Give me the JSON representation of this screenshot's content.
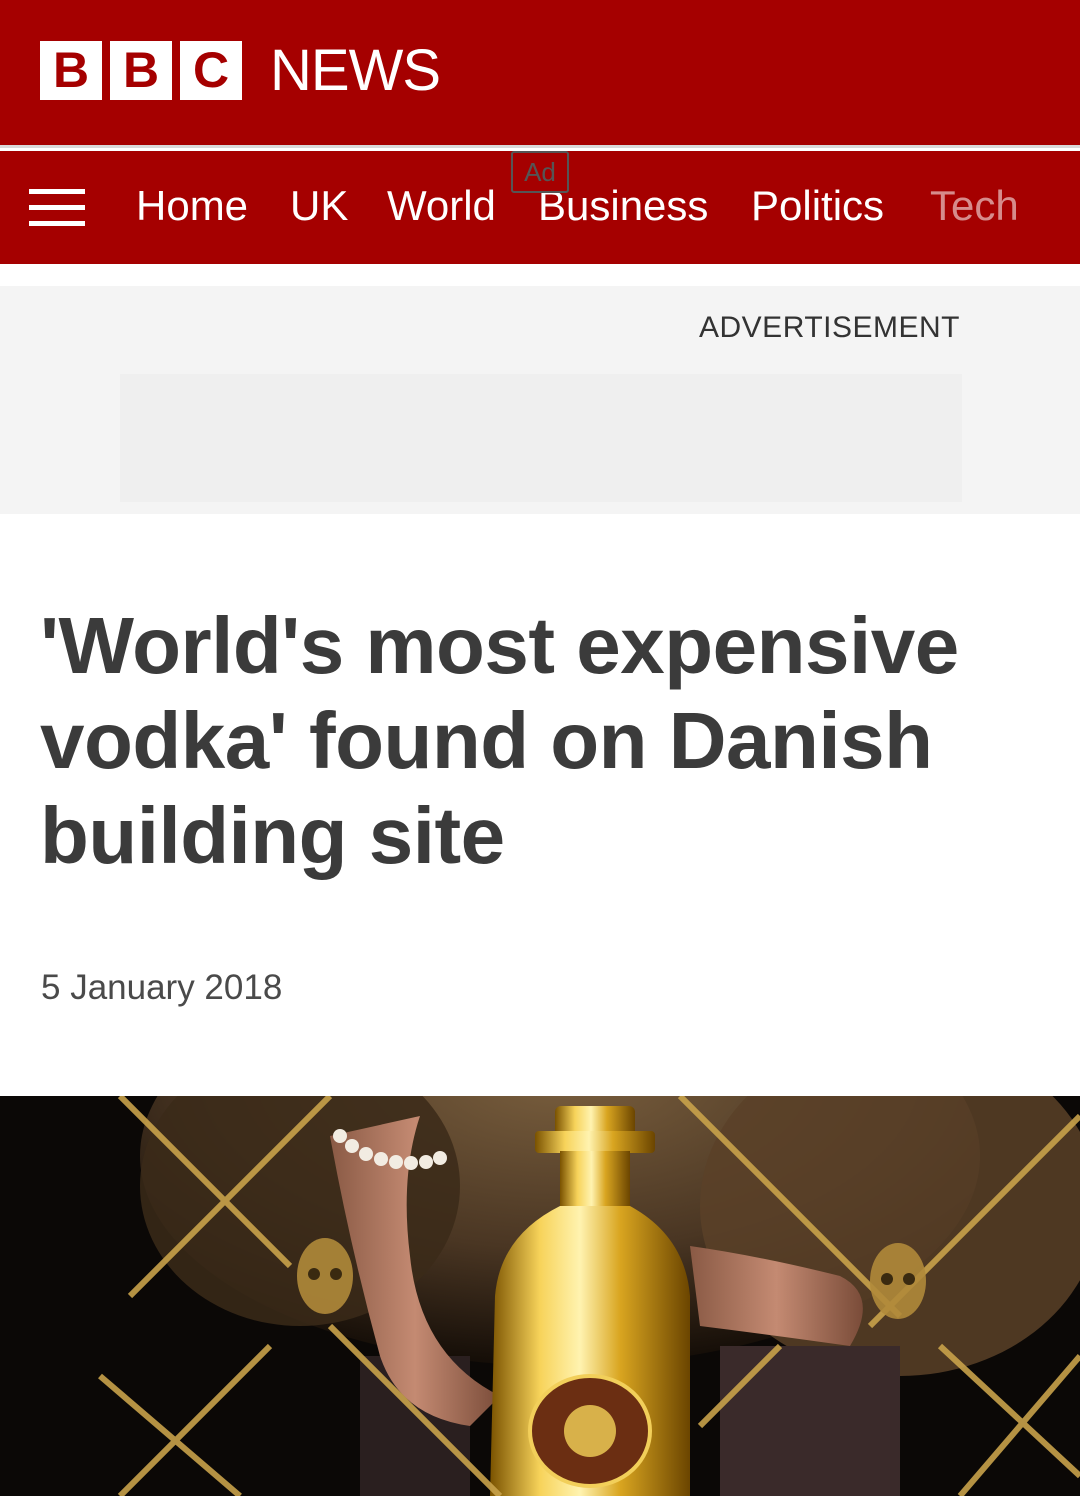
{
  "masthead": {
    "logo_letters": [
      "B",
      "B",
      "C"
    ],
    "news_label": "NEWS",
    "brand_color": "#a50000"
  },
  "nav": {
    "menu_icon": "hamburger-menu-icon",
    "items": [
      {
        "label": "Home"
      },
      {
        "label": "UK"
      },
      {
        "label": "World"
      },
      {
        "label": "Business"
      },
      {
        "label": "Politics"
      },
      {
        "label": "Tech"
      }
    ]
  },
  "ad": {
    "label": "ADVERTISEMENT",
    "badge": "Ad"
  },
  "article": {
    "headline": "'World's most expensive vodka' found on Danish building site",
    "date": "5 January 2018"
  },
  "hero_image": {
    "description_icon": "vodka-bottle-photo"
  }
}
